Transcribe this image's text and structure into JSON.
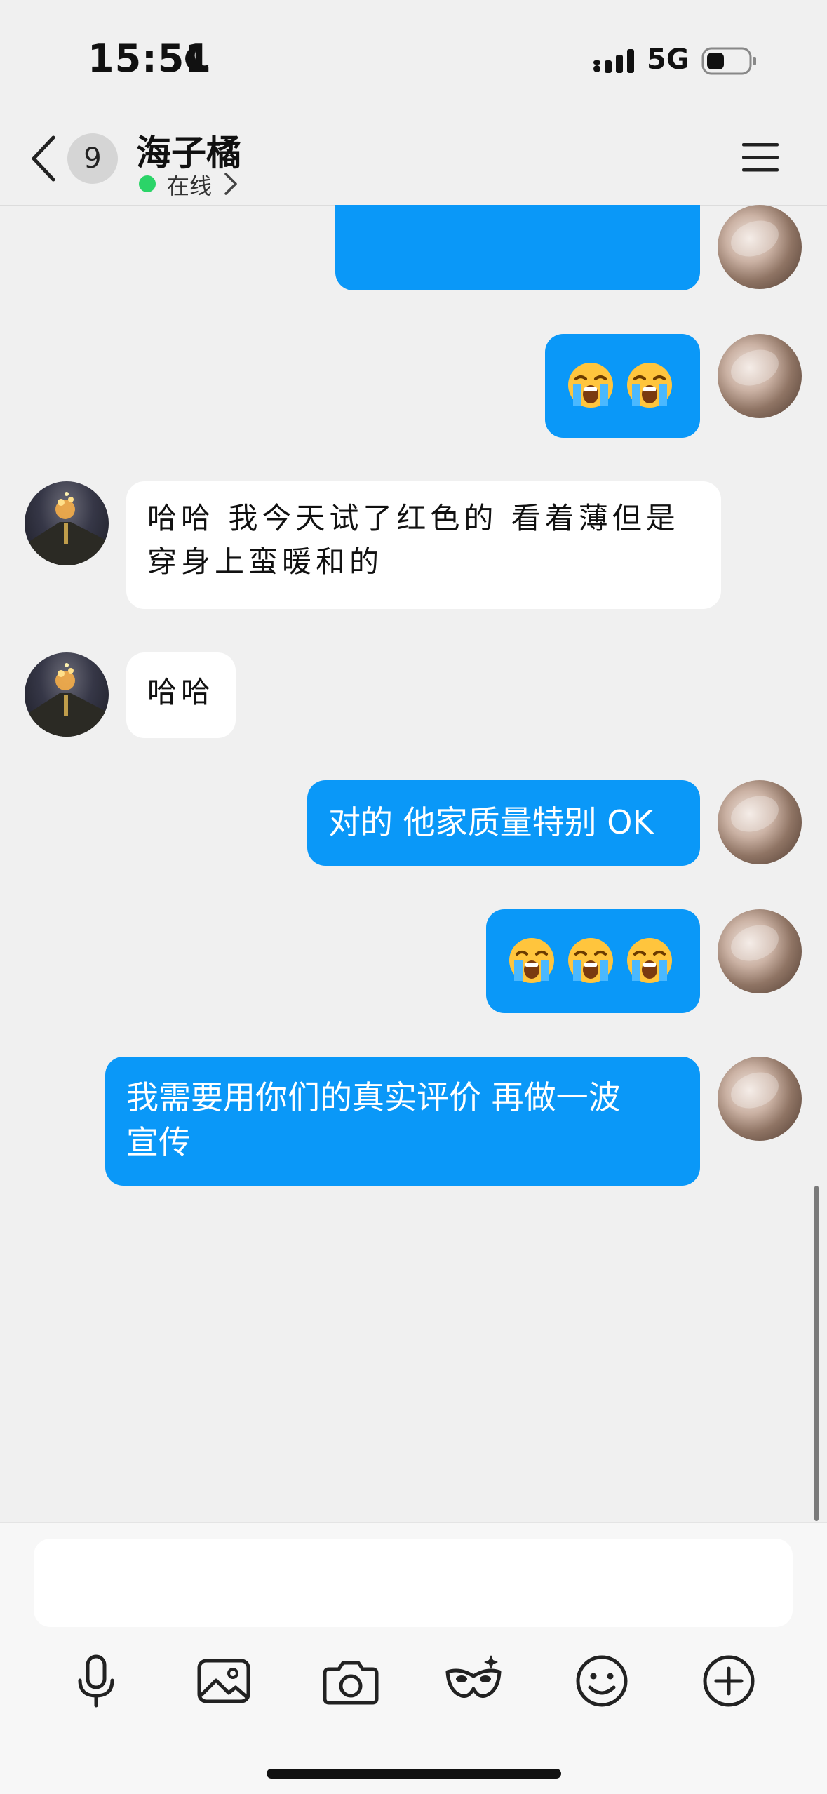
{
  "status_bar": {
    "time": "15:51",
    "network": "5G",
    "icons": [
      "moon-icon",
      "signal-icon",
      "battery-icon"
    ]
  },
  "header": {
    "back_badge_count": "9",
    "contact_name": "海子橘",
    "status": "在线"
  },
  "messages": [
    {
      "direction": "outgoing",
      "type": "text",
      "text": "",
      "note": "partially obscured"
    },
    {
      "direction": "outgoing",
      "type": "emoji",
      "emojis": [
        "loudly-crying-face",
        "loudly-crying-face"
      ]
    },
    {
      "direction": "incoming",
      "type": "text",
      "lines": [
        "哈哈 我今天试了红色的 看着薄但是",
        "穿身上蛮暖和的"
      ]
    },
    {
      "direction": "incoming",
      "type": "text",
      "text": "哈哈"
    },
    {
      "direction": "outgoing",
      "type": "text",
      "text": "对的 他家质量特别 OK"
    },
    {
      "direction": "outgoing",
      "type": "emoji",
      "emojis": [
        "loudly-crying-face",
        "loudly-crying-face",
        "loudly-crying-face"
      ]
    },
    {
      "direction": "outgoing",
      "type": "text",
      "lines": [
        "我需要用你们的真实评价 再做一波",
        "宣传"
      ]
    }
  ],
  "composer": {
    "input_value": "",
    "tools": [
      "microphone-icon",
      "image-icon",
      "camera-icon",
      "mask-icon",
      "smiley-icon",
      "plus-icon"
    ]
  },
  "colors": {
    "outgoing_bubble": "#0a98f8",
    "incoming_bubble": "#ffffff",
    "background": "#f0f0f0",
    "online": "#2bd468"
  }
}
